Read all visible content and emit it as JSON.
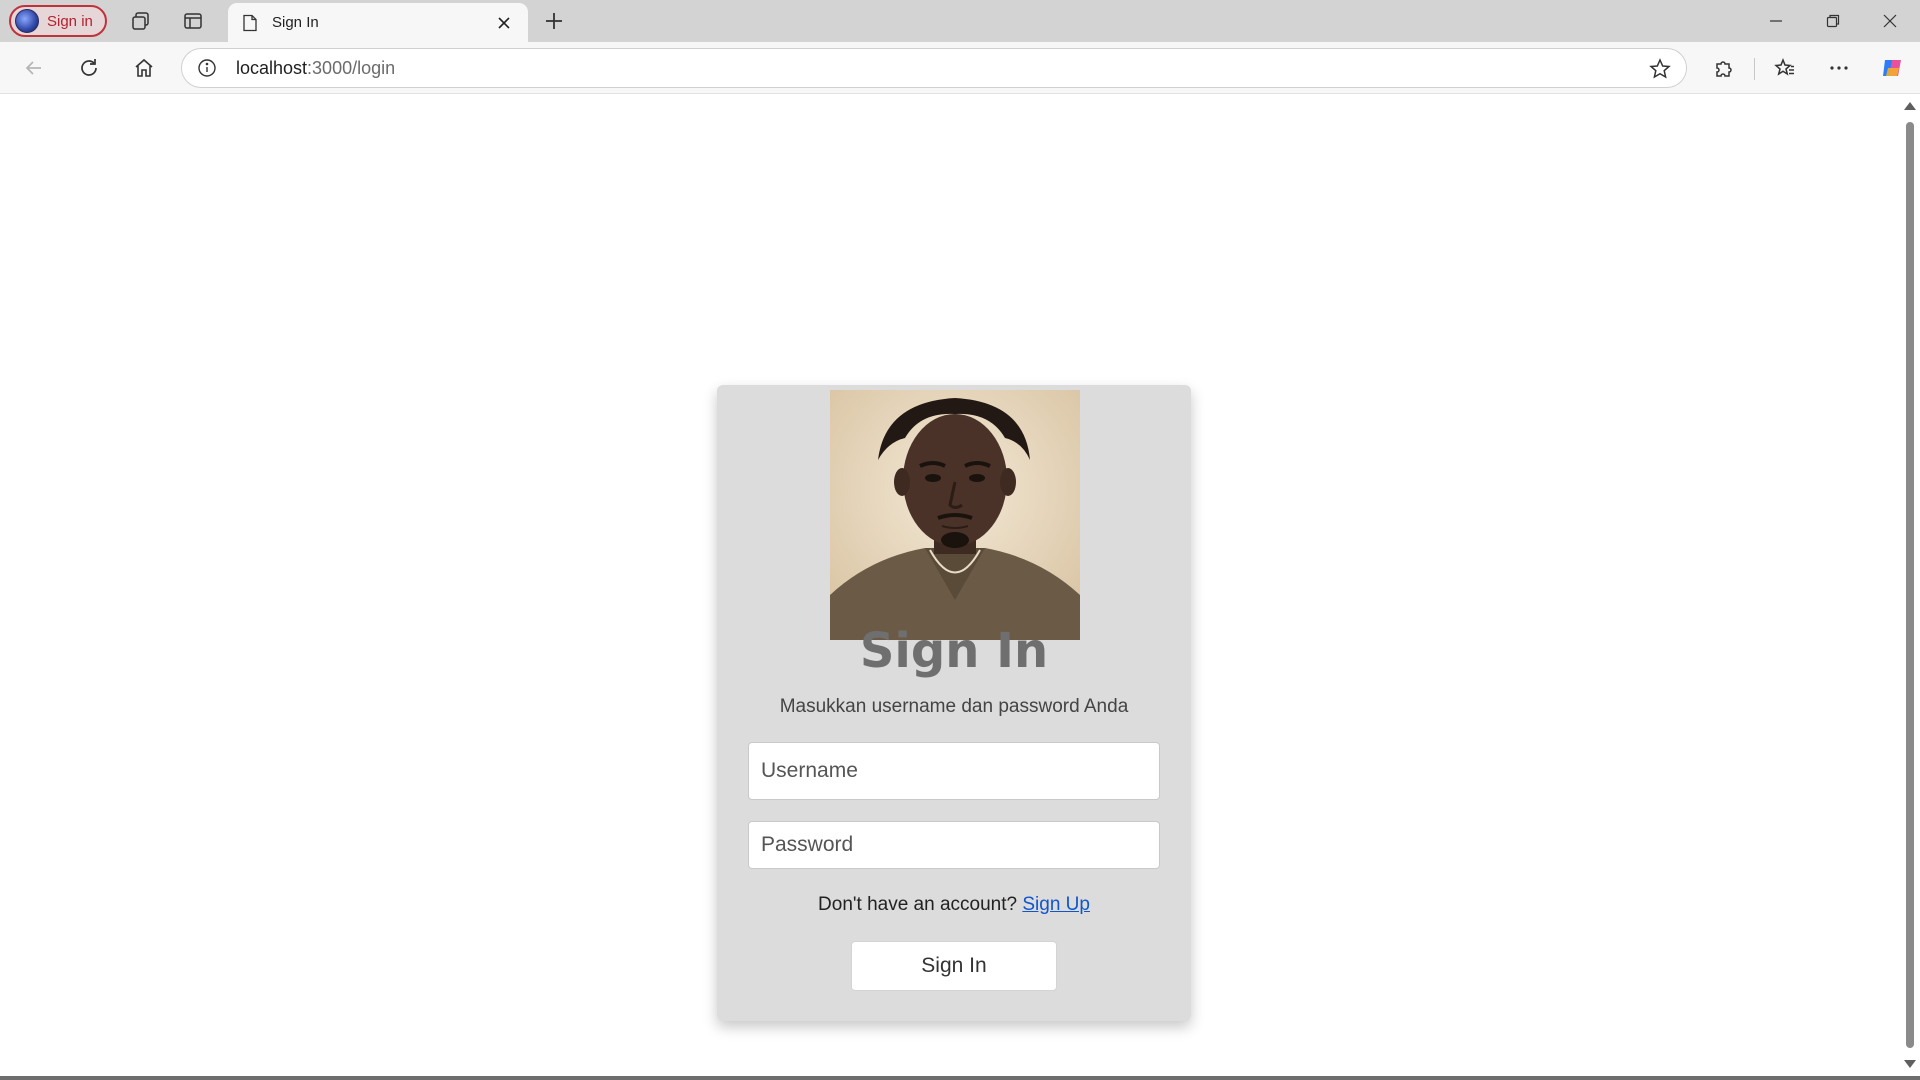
{
  "browser": {
    "profile_label": "Sign in",
    "tab_title": "Sign In",
    "url_host": "localhost",
    "url_path": ":3000/login"
  },
  "login": {
    "title": "Sign In",
    "subtitle": "Masukkan username dan password Anda",
    "username_placeholder": "Username",
    "password_placeholder": "Password",
    "signup_prompt": "Don't have an account?",
    "signup_link": "Sign Up",
    "submit_label": "Sign In"
  },
  "colors": {
    "card_background": "#dcdcdc",
    "link": "#1155cc",
    "profile_accent": "#c0323a"
  }
}
